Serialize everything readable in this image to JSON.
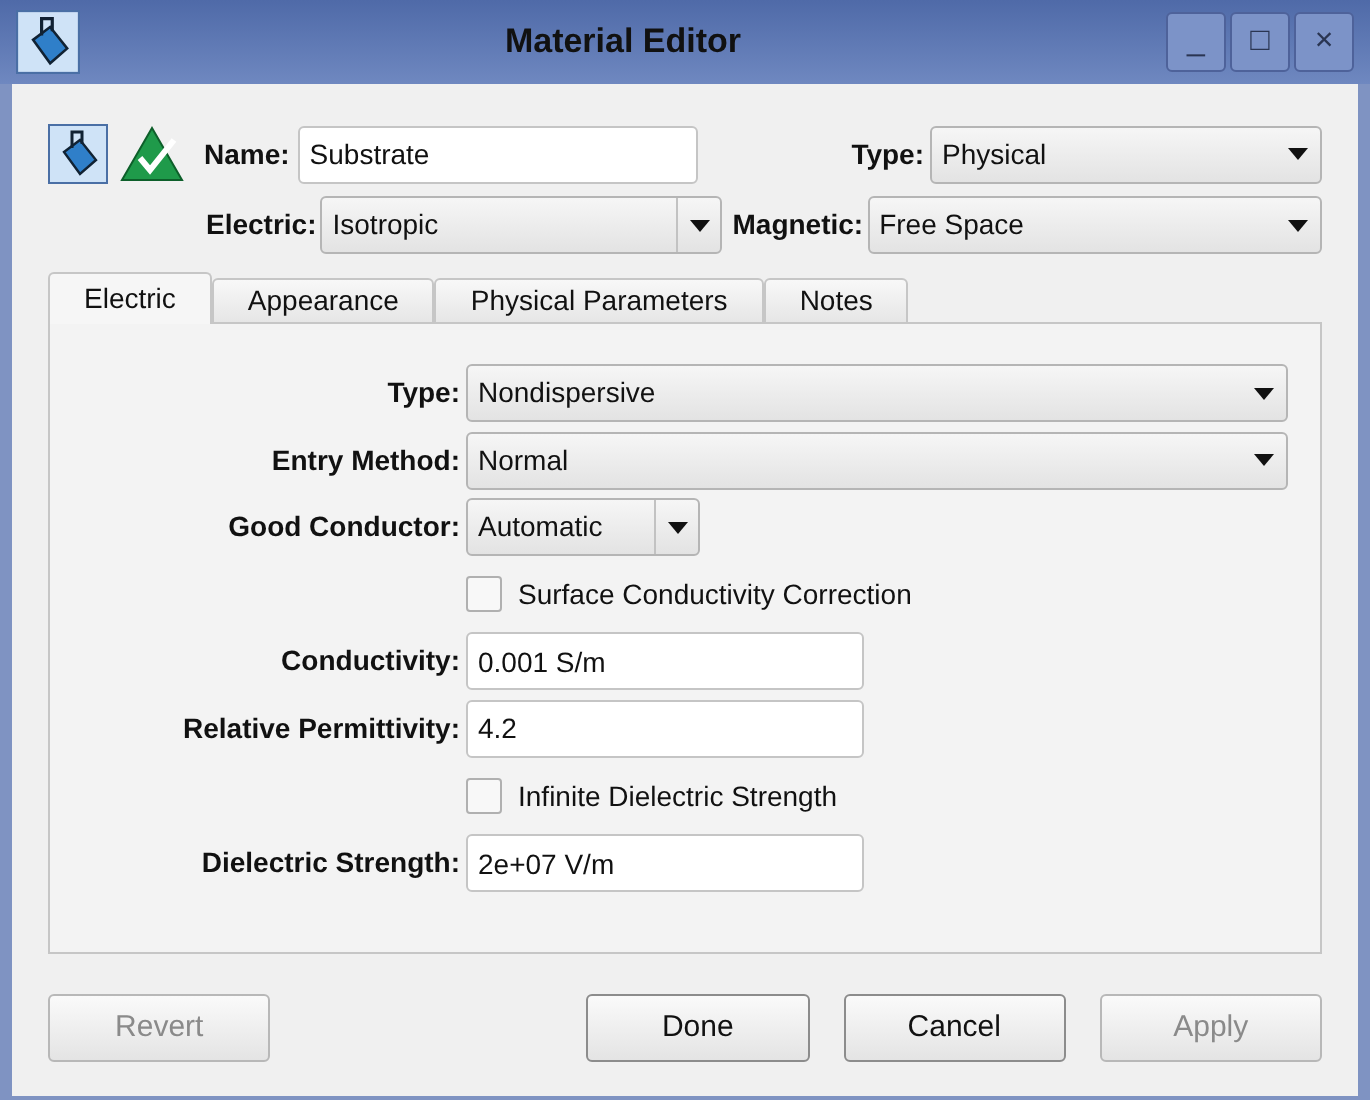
{
  "window": {
    "title": "Material Editor",
    "controls": [
      "_",
      "□",
      "×"
    ]
  },
  "header": {
    "name": {
      "label": "Name:",
      "value": "Substrate"
    },
    "type": {
      "label": "Type:",
      "value": "Physical"
    },
    "electric": {
      "label": "Electric:",
      "value": "Isotropic"
    },
    "magnetic": {
      "label": "Magnetic:",
      "value": "Free Space"
    }
  },
  "tabs": [
    {
      "label": "Electric",
      "selected": true
    },
    {
      "label": "Appearance",
      "selected": false
    },
    {
      "label": "Physical Parameters",
      "selected": false
    },
    {
      "label": "Notes",
      "selected": false
    }
  ],
  "rows": [
    {
      "kind": "dropdown",
      "label": "Type:",
      "value": "Nondispersive"
    },
    {
      "kind": "dropdown",
      "label": "Entry Method:",
      "value": "Normal"
    },
    {
      "kind": "combo",
      "label": "Good Conductor:",
      "value": "Automatic"
    },
    {
      "kind": "checkbox",
      "label": "Surface Conductivity Correction",
      "checked": false
    },
    {
      "kind": "field",
      "label": "Conductivity:",
      "value": "0.001 S/m"
    },
    {
      "kind": "field",
      "label": "Relative Permittivity:",
      "value": "4.2"
    },
    {
      "kind": "checkbox",
      "label": "Infinite Dielectric Strength",
      "checked": false
    },
    {
      "kind": "field",
      "label": "Dielectric Strength:",
      "value": "2e+07 V/m"
    }
  ],
  "buttons": [
    {
      "label": "Revert",
      "disabled": true
    },
    {
      "label": "Done",
      "disabled": false
    },
    {
      "label": "Cancel",
      "disabled": false
    },
    {
      "label": "Apply",
      "disabled": true
    }
  ]
}
